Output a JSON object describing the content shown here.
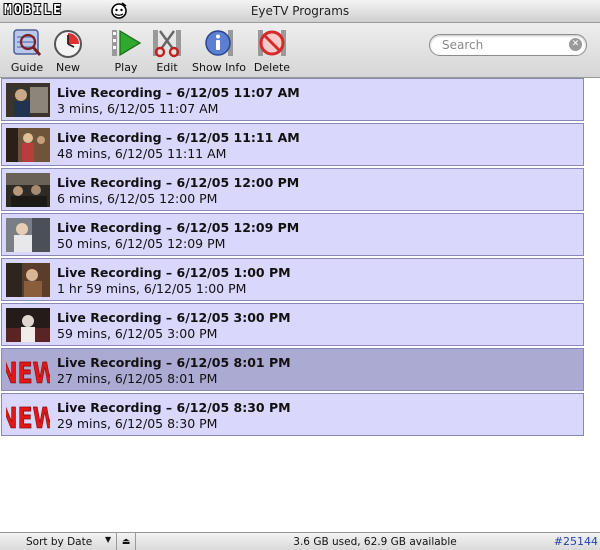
{
  "window": {
    "title": "EyeTV Programs",
    "logo_text": "MOBILE"
  },
  "toolbar": {
    "buttons": [
      {
        "label": "Guide",
        "icon": "guide-icon"
      },
      {
        "label": "New",
        "icon": "clock-icon"
      },
      {
        "label": "Play",
        "icon": "play-icon"
      },
      {
        "label": "Edit",
        "icon": "scissors-icon"
      },
      {
        "label": "Show Info",
        "icon": "info-icon"
      },
      {
        "label": "Delete",
        "icon": "delete-icon"
      }
    ],
    "search": {
      "placeholder": "Search",
      "value": ""
    }
  },
  "programs": [
    {
      "title": "Live Recording – 6/12/05 11:07 AM",
      "subtitle": "3 mins, 6/12/05 11:07 AM",
      "thumb": "video"
    },
    {
      "title": "Live Recording – 6/12/05 11:11 AM",
      "subtitle": "48 mins, 6/12/05 11:11 AM",
      "thumb": "video"
    },
    {
      "title": "Live Recording – 6/12/05 12:00 PM",
      "subtitle": "6 mins, 6/12/05 12:00 PM",
      "thumb": "video"
    },
    {
      "title": "Live Recording – 6/12/05 12:09 PM",
      "subtitle": "50 mins, 6/12/05 12:09 PM",
      "thumb": "video"
    },
    {
      "title": "Live Recording – 6/12/05 1:00 PM",
      "subtitle": "1 hr 59 mins, 6/12/05 1:00 PM",
      "thumb": "video"
    },
    {
      "title": "Live Recording – 6/12/05 3:00 PM",
      "subtitle": "59 mins, 6/12/05 3:00 PM",
      "thumb": "video"
    },
    {
      "title": "Live Recording – 6/12/05 8:01 PM",
      "subtitle": "27 mins, 6/12/05 8:01 PM",
      "thumb": "new",
      "badge": "NEW",
      "selected": true
    },
    {
      "title": "Live Recording – 6/12/05 8:30 PM",
      "subtitle": "29 mins, 6/12/05 8:30 PM",
      "thumb": "new",
      "badge": "NEW"
    }
  ],
  "statusbar": {
    "sort_label": "Sort by Date",
    "storage": "3.6 GB used, 62.9 GB available",
    "tag": "#25144"
  },
  "colors": {
    "row": "#d9d7fb",
    "row_selected": "#abaad3",
    "new_badge": "#e01818"
  }
}
